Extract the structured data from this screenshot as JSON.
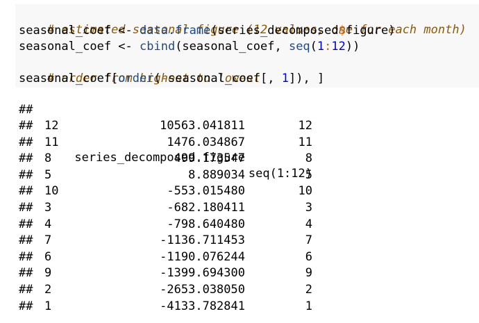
{
  "code": {
    "comment1": "# estimated seasonal figure (12 values, one for each month)",
    "l2_a": "seasonal_coef <- ",
    "l2_fn": "data.frame",
    "l2_b": "(series_decomposed",
    "l2_op": "$",
    "l2_c": "figure)",
    "l3_a": "seasonal_coef <- ",
    "l3_fn1": "cbind",
    "l3_b": "(seasonal_coef, ",
    "l3_fn2": "seq",
    "l3_c": "(",
    "l3_n1": "1",
    "l3_op": ":",
    "l3_n2": "12",
    "l3_d": "))",
    "comment2": "# order from highest to lowest",
    "l5_a": "seasonal_coef[",
    "l5_fn": "order",
    "l5_b": "(",
    "l5_op": "-",
    "l5_c": "seasonal_coef[, ",
    "l5_n": "1",
    "l5_d": "]), ]"
  },
  "output": {
    "prefix": "##",
    "header_fig": "series_decomposed.figure",
    "header_seq": "seq(1:12)",
    "rows": [
      {
        "row": "12",
        "fig": "10563.041811",
        "seq": "12"
      },
      {
        "row": "11",
        "fig": "1476.034867",
        "seq": "11"
      },
      {
        "row": "8",
        "fig": "499.173547",
        "seq": "8"
      },
      {
        "row": "5",
        "fig": "8.889034",
        "seq": "5"
      },
      {
        "row": "10",
        "fig": "-553.015480",
        "seq": "10"
      },
      {
        "row": "3",
        "fig": "-682.180411",
        "seq": "3"
      },
      {
        "row": "4",
        "fig": "-798.640480",
        "seq": "4"
      },
      {
        "row": "7",
        "fig": "-1136.711453",
        "seq": "7"
      },
      {
        "row": "6",
        "fig": "-1190.076244",
        "seq": "6"
      },
      {
        "row": "9",
        "fig": "-1399.694300",
        "seq": "9"
      },
      {
        "row": "2",
        "fig": "-2653.038050",
        "seq": "2"
      },
      {
        "row": "1",
        "fig": "-4133.782841",
        "seq": "1"
      }
    ]
  }
}
